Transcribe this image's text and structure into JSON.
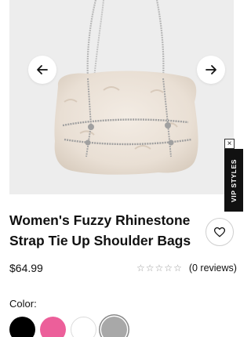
{
  "product": {
    "title": "Women's Fuzzy Rhinestone Strap Tie Up Shoulder Bags",
    "price": "$64.99",
    "rating_stars": 0,
    "reviews_text": "(0 reviews)"
  },
  "gallery": {
    "prev_icon": "arrow-left-icon",
    "next_icon": "arrow-right-icon",
    "background_color": "#ededed"
  },
  "vip_tab": {
    "label": "VIP STYLES",
    "close_glyph": "×"
  },
  "favorite": {
    "icon": "heart-icon"
  },
  "color_picker": {
    "label": "Color:",
    "options": [
      {
        "name": "black",
        "color": "#000000"
      },
      {
        "name": "pink",
        "color": "#ec5f9a"
      },
      {
        "name": "white",
        "color": "#ffffff"
      },
      {
        "name": "silver",
        "color": "#a8a8a8",
        "selected": true
      }
    ]
  }
}
